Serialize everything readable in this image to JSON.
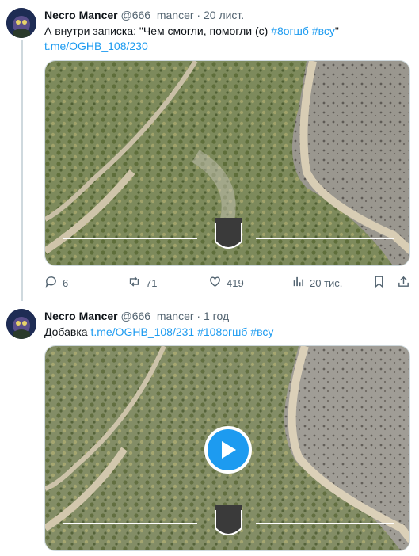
{
  "tweets": [
    {
      "author_name": "Necro Mancer",
      "author_handle": "@666_mancer",
      "separator": "·",
      "timestamp": "20 лист.",
      "text": "А внутри записка: \"Чем смогли, помогли (с) ",
      "hashtags": [
        "#8огшб",
        "#всу"
      ],
      "text_tail": "\"",
      "link": "t.me/OGHB_108/230",
      "media_type": "image",
      "stats": {
        "replies": "6",
        "retweets": "71",
        "likes": "419",
        "views": "20 тис."
      }
    },
    {
      "author_name": "Necro Mancer",
      "author_handle": "@666_mancer",
      "separator": "·",
      "timestamp": "1 год",
      "text": "Добавка ",
      "link": "t.me/OGHB_108/231",
      "hashtags": [
        "#108огшб",
        "#всу"
      ],
      "media_type": "video"
    }
  ],
  "icons": [
    "avatar",
    "reply-icon",
    "retweet-icon",
    "like-icon",
    "views-icon",
    "bookmark-icon",
    "share-icon",
    "play-icon",
    "unit-patch-logo"
  ],
  "colors": {
    "accent": "#1d9bf0",
    "muted": "#536471",
    "text": "#0f1419",
    "border": "#cfd9de"
  }
}
